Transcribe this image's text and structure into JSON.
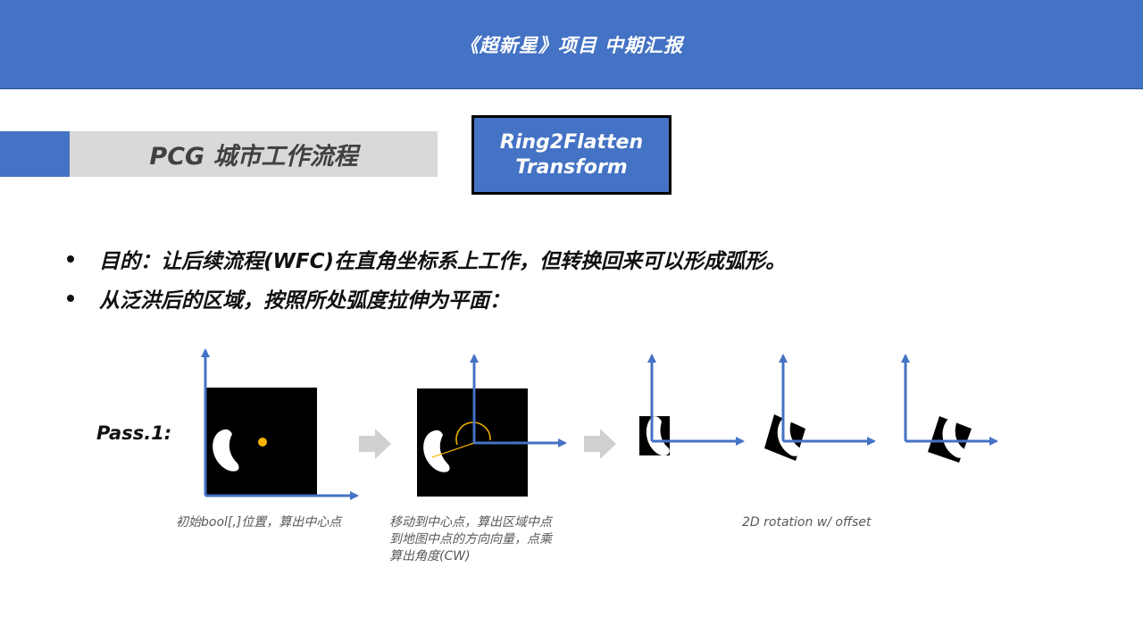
{
  "header": {
    "title": "《超新星》项目 中期汇报"
  },
  "section": {
    "title": "PCG 城市工作流程"
  },
  "tag": {
    "line1": "Ring2Flatten",
    "line2": "Transform"
  },
  "bullets": [
    "目的：让后续流程(WFC)在直角坐标系上工作，但转换回来可以形成弧形。",
    "从泛洪后的区域，按照所处弧度拉伸为平面："
  ],
  "diagram": {
    "pass_label": "Pass.1:",
    "captions": {
      "step1": "初始bool[,]位置，算出中心点",
      "step2_line1": "移动到中心点，算出区域中点",
      "step2_line2": "到地图中点的方向向量，点乘",
      "step2_line3": "算出角度(CW)",
      "step3": "2D rotation w/ offset"
    },
    "colors": {
      "axis": "#4472c4",
      "center_point": "#f5b301",
      "arrow": "#d0d0d0"
    }
  }
}
